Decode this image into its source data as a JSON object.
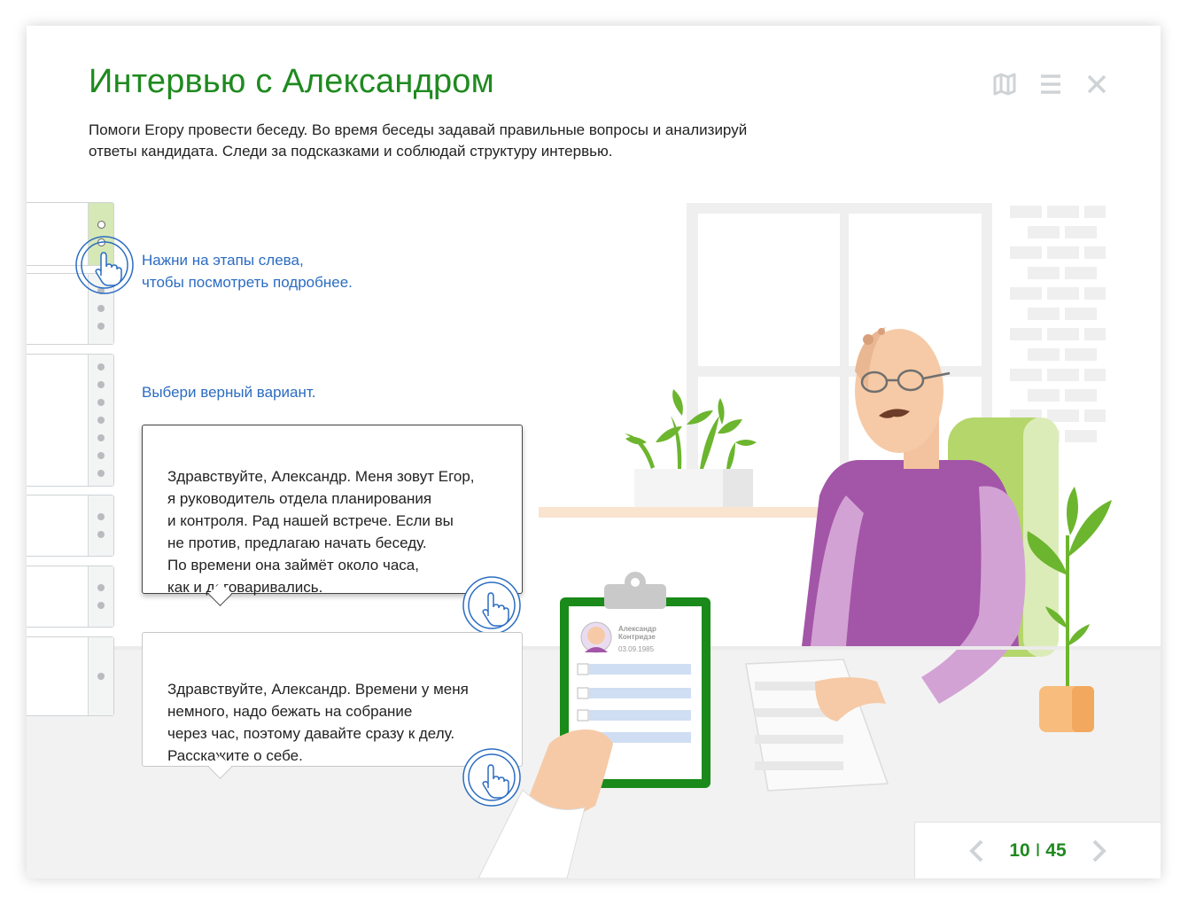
{
  "header": {
    "title": "Интервью с Александром",
    "subtitle": "Помоги Егору провести беседу. Во время беседы задавай правильные вопросы и анализируй\nответы кандидата. Следи за подсказками и соблюдай структуру интервью."
  },
  "toolbar": {
    "map_icon": "map-icon",
    "menu_icon": "menu-icon",
    "close_icon": "close-icon"
  },
  "hint": {
    "text": "Нажни на этапы слева,\nчтобы посмотреть подробнее."
  },
  "prompt": "Выбери верный вариант.",
  "options": [
    {
      "text": "Здравствуйте, Александр. Меня зовут Егор,\nя руководитель отдела планирования\nи контроля. Рад нашей встрече. Если вы\nне против, предлагаю начать беседу.\nПо времени она займёт около часа,\nкак и договаривались."
    },
    {
      "text": "Здравствуйте, Александр. Времени у меня\nнемного, надо бежать на собрание\nчерез час, поэтому давайте сразу к делу.\nРасскажите о себе."
    }
  ],
  "clipboard": {
    "name": "Александр\nКонтридзе",
    "date": "03.09.1985"
  },
  "pager": {
    "current": "10",
    "separator": "I",
    "total": "45"
  },
  "colors": {
    "brand_green": "#1f8a1f",
    "hint_blue": "#2b6cc2",
    "accent_purple": "#a355a8"
  }
}
